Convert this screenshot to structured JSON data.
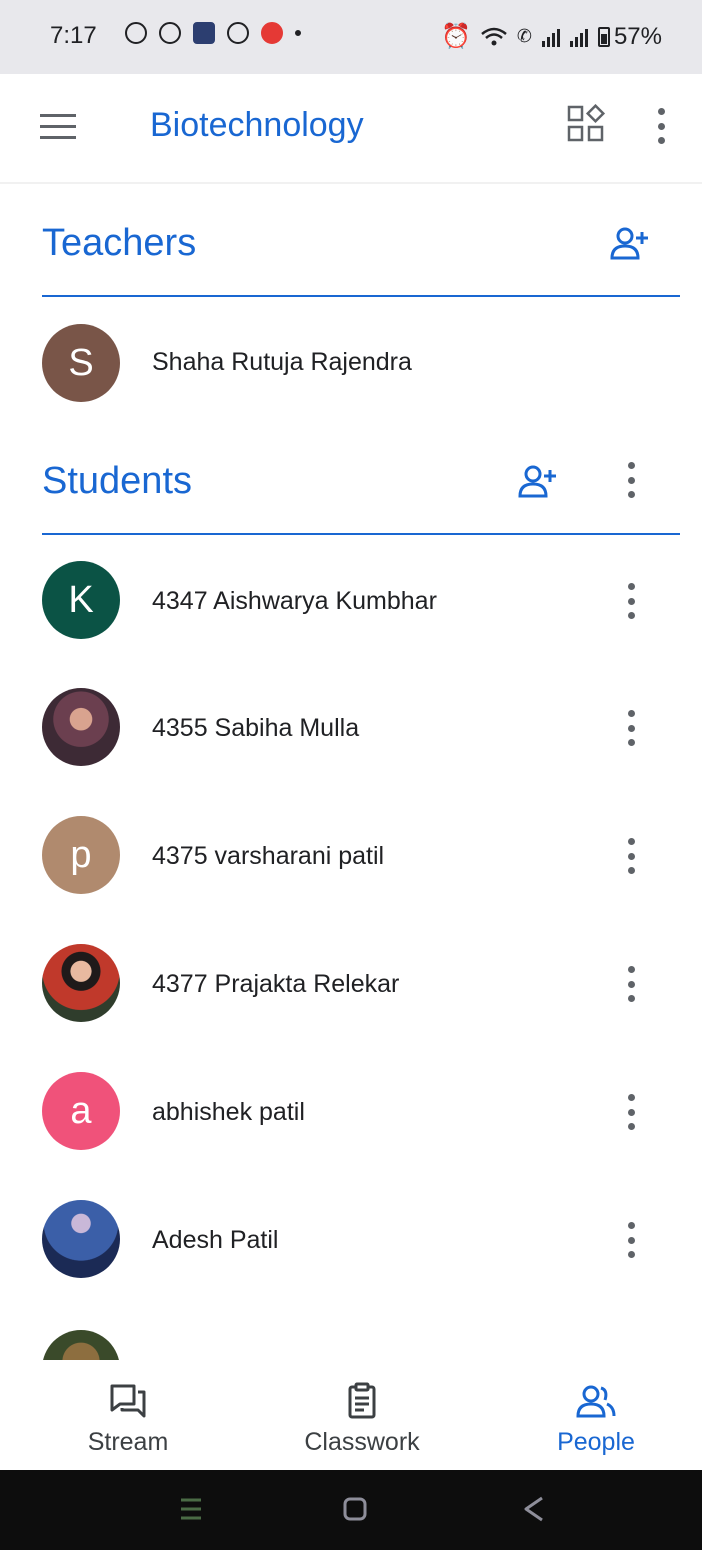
{
  "status_bar": {
    "time": "7:17",
    "battery": "57%"
  },
  "app_bar": {
    "title": "Biotechnology",
    "icons": [
      "menu-icon",
      "class-code-icon",
      "more-vert-icon"
    ]
  },
  "teachers": {
    "heading": "Teachers",
    "people": [
      {
        "initial": "S",
        "name": "Shaha Rutuja Rajendra",
        "color": "#795548"
      }
    ]
  },
  "students": {
    "heading": "Students",
    "people": [
      {
        "initial": "K",
        "name": "4347 Aishwarya Kumbhar",
        "color": "#0b5345",
        "photo": false
      },
      {
        "initial": "",
        "name": "4355 Sabiha Mulla",
        "color": "#6b3f4f",
        "photo": true
      },
      {
        "initial": "p",
        "name": "4375 varsharani patil",
        "color": "#b08a6e",
        "photo": false
      },
      {
        "initial": "",
        "name": "4377 Prajakta Relekar",
        "color": "#c0392b",
        "photo": true
      },
      {
        "initial": "a",
        "name": "abhishek patil",
        "color": "#f0527a",
        "photo": false
      },
      {
        "initial": "",
        "name": "Adesh Patil",
        "color": "#3b5fa8",
        "photo": true
      }
    ]
  },
  "bottom_nav": {
    "items": [
      {
        "label": "Stream",
        "active": false
      },
      {
        "label": "Classwork",
        "active": false
      },
      {
        "label": "People",
        "active": true
      }
    ]
  },
  "colors": {
    "accent": "#1967d2",
    "icon_gray": "#5f6368"
  }
}
